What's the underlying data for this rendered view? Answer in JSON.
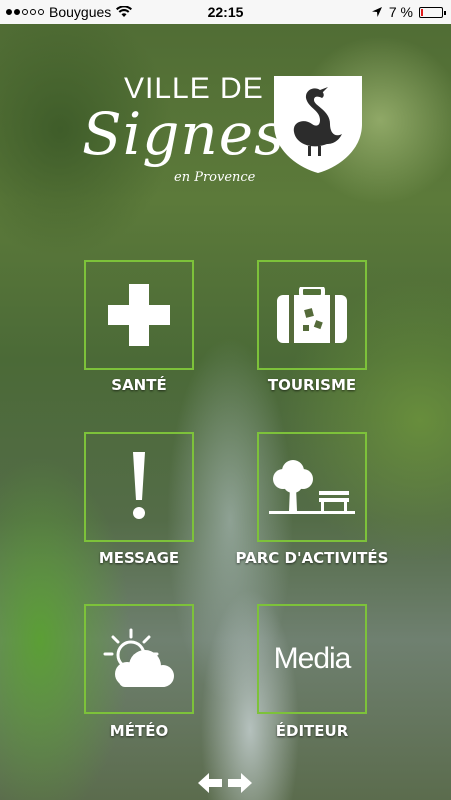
{
  "status_bar": {
    "carrier": "Bouygues",
    "signal_bars": 2,
    "time": "22:15",
    "battery_percent": "7 %"
  },
  "header": {
    "line1": "VILLE DE",
    "line2": "Signes",
    "line3": "en Provence",
    "crest_icon": "swan-shield-icon"
  },
  "tiles": [
    {
      "label": "SANTÉ",
      "icon": "medical-cross-icon"
    },
    {
      "label": "TOURISME",
      "icon": "suitcase-icon"
    },
    {
      "label": "MESSAGE",
      "icon": "exclamation-icon"
    },
    {
      "label": "PARC D'ACTIVITÉS",
      "icon": "tree-bench-icon"
    },
    {
      "label": "MÉTÉO",
      "icon": "sun-cloud-icon"
    },
    {
      "label": "ÉDITEUR",
      "icon": "media-logo-icon",
      "logo_text": "Media"
    }
  ],
  "colors": {
    "tile_border": "#7dc23a",
    "battery_low": "#e01b1b"
  },
  "navigation": {
    "prev_icon": "arrow-left-icon",
    "next_icon": "arrow-right-icon"
  }
}
